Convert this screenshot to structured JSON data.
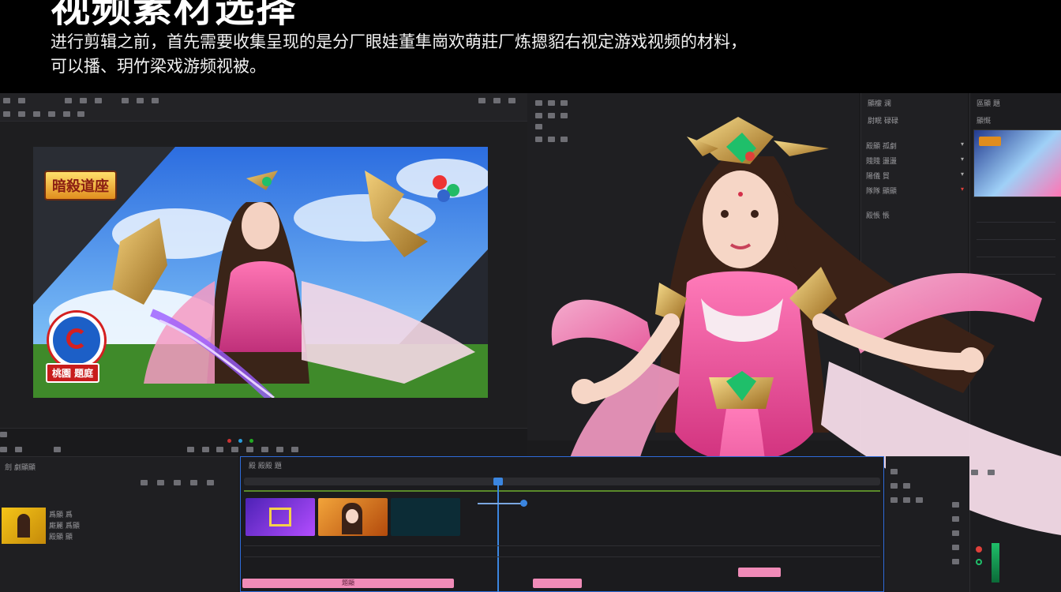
{
  "banner": {
    "headline": "视频素材选择",
    "intro_line1": "进行剪辑之前，首先需要收集呈现的是分厂眼娃董隼崗欢萌莊厂炼摁貂右视定游戏视频的材料，",
    "intro_line2": "可以播、玥竹梁戏游频视被。"
  },
  "preview": {
    "game_logo": "暗殺道座",
    "badge_text": "桃園 題庭"
  },
  "inspector": {
    "title": "顯檬 澜",
    "rows": [
      "尉眠 碌碌",
      "殿顯 孤劇",
      "賤賤 盪盪",
      "陽儀 貿",
      "隊隊 顯顯",
      "殿悵 悵"
    ]
  },
  "media": {
    "title": "區顯 題",
    "sub": "顯慨"
  },
  "project": {
    "title": "劍 劇顯顯",
    "items": [
      "爲顯 爲",
      "廝麗 爲顯",
      "殿顯 顯"
    ]
  },
  "timeline": {
    "title": "殿 殿殿 題",
    "clip_names": [
      "purple-clip",
      "character-clip",
      "dark-clip"
    ],
    "bar_label": "題顯"
  },
  "colors": {
    "timeline_border": "#2f6bd9",
    "playhead": "#3b86e0",
    "clip_pink": "#f08bb8",
    "accent_green": "#1fbf6a",
    "accent_red": "#e0403a"
  }
}
